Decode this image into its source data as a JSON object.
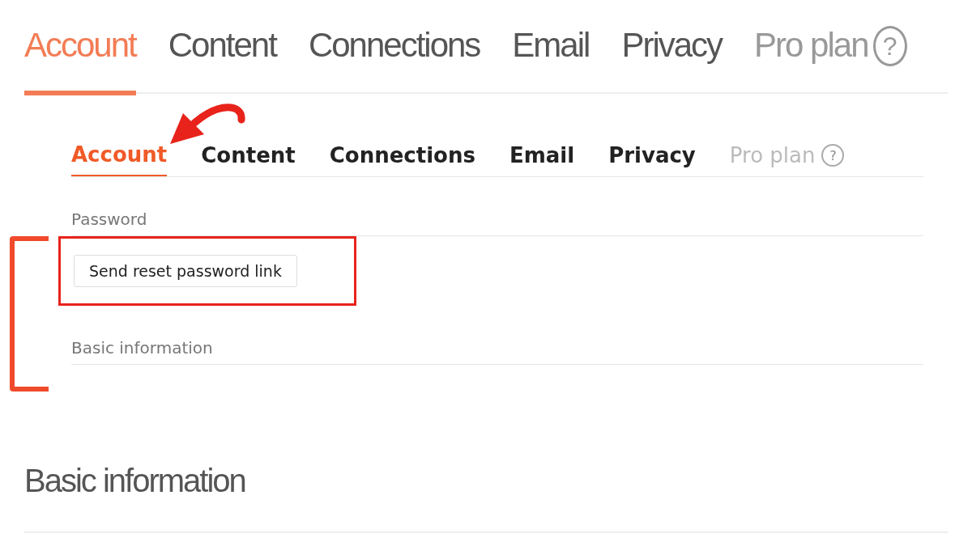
{
  "background": {
    "tabs": [
      {
        "label": "Account",
        "selected": true,
        "disabled": false
      },
      {
        "label": "Content",
        "selected": false,
        "disabled": false
      },
      {
        "label": "Connections",
        "selected": false,
        "disabled": false
      },
      {
        "label": "Email",
        "selected": false,
        "disabled": false
      },
      {
        "label": "Privacy",
        "selected": false,
        "disabled": false
      },
      {
        "label": "Pro plan",
        "selected": false,
        "disabled": true,
        "badge": "?"
      }
    ],
    "section": "Basic information"
  },
  "inset": {
    "tabs": [
      {
        "label": "Account",
        "selected": true,
        "disabled": false
      },
      {
        "label": "Content",
        "selected": false,
        "disabled": false
      },
      {
        "label": "Connections",
        "selected": false,
        "disabled": false
      },
      {
        "label": "Email",
        "selected": false,
        "disabled": false
      },
      {
        "label": "Privacy",
        "selected": false,
        "disabled": false
      },
      {
        "label": "Pro plan",
        "selected": false,
        "disabled": true,
        "badge": "?"
      }
    ],
    "sections": [
      {
        "title": "Password",
        "button": "Send reset password link",
        "highlighted": true
      },
      {
        "title": "Basic information"
      }
    ]
  }
}
